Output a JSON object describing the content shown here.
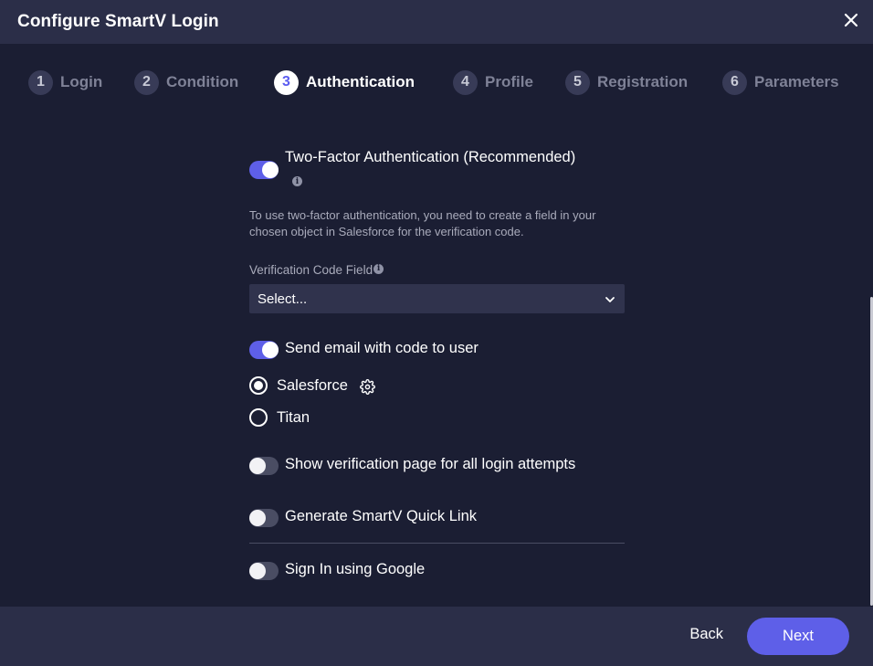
{
  "dialog": {
    "title": "Configure SmartV Login",
    "close_icon": "close-icon"
  },
  "steps": [
    {
      "num": "1",
      "label": "Login"
    },
    {
      "num": "2",
      "label": "Condition"
    },
    {
      "num": "3",
      "label": "Authentication",
      "active": true
    },
    {
      "num": "4",
      "label": "Profile"
    },
    {
      "num": "5",
      "label": "Registration"
    },
    {
      "num": "6",
      "label": "Parameters"
    }
  ],
  "two_factor": {
    "label": "Two-Factor Authentication (Recommended)",
    "enabled": true,
    "info_glyph": "i",
    "help_text": "To use two-factor authentication, you need to create a field in your chosen object in Salesforce for the verification code."
  },
  "verification_field": {
    "label": "Verification Code Field",
    "info_glyph": "i",
    "value": "Select..."
  },
  "send_email": {
    "label": "Send email with code to user",
    "enabled": true,
    "options": [
      {
        "label": "Salesforce",
        "checked": true
      },
      {
        "label": "Titan",
        "checked": false
      }
    ]
  },
  "show_verification": {
    "label": "Show verification page for all login attempts",
    "enabled": false
  },
  "quick_link": {
    "label": "Generate SmartV Quick Link",
    "enabled": false
  },
  "google_sign_in": {
    "label": "Sign In using Google",
    "enabled": false
  },
  "footer": {
    "back_label": "Back",
    "next_label": "Next"
  },
  "colors": {
    "accent": "#5e5fe8",
    "background": "#1b1e33",
    "header": "#2b2e48"
  }
}
